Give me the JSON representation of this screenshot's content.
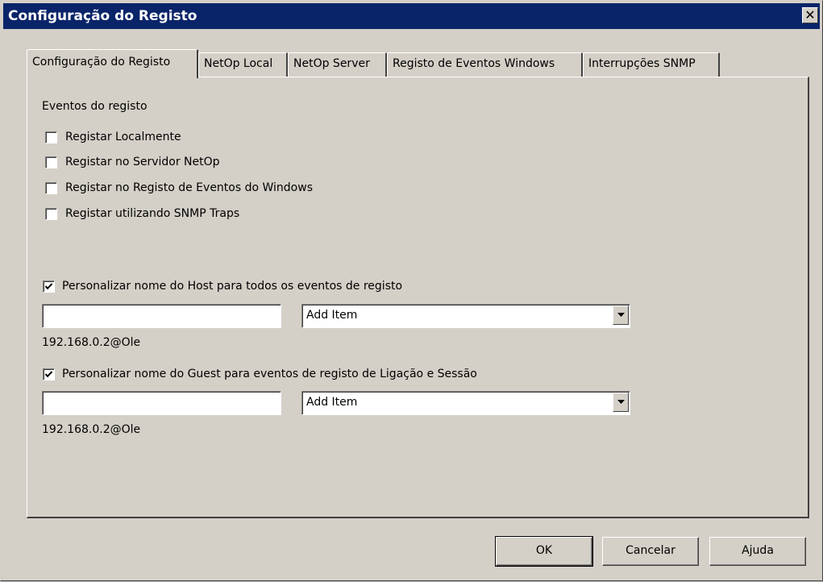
{
  "window": {
    "title": "Configuração do Registo",
    "close_glyph": "✕"
  },
  "tabs": [
    {
      "label": "Configuração do Registo",
      "active": true
    },
    {
      "label": "NetOp Local",
      "active": false
    },
    {
      "label": "NetOp Server",
      "active": false
    },
    {
      "label": "Registo de Eventos Windows",
      "active": false
    },
    {
      "label": "Interrupções SNMP",
      "active": false
    }
  ],
  "events": {
    "group_label": "Eventos do registo",
    "options": [
      {
        "label": "Registar Localmente",
        "checked": false
      },
      {
        "label": "Registar no Servidor NetOp",
        "checked": false
      },
      {
        "label": "Registar no Registo de Eventos do Windows",
        "checked": false
      },
      {
        "label": "Registar utilizando SNMP Traps",
        "checked": false
      }
    ]
  },
  "host": {
    "checkbox_label": "Personalizar nome do Host para todos os eventos de registo",
    "checked": true,
    "text_value": "",
    "combo_value": "Add Item",
    "preview": "192.168.0.2@Ole"
  },
  "guest": {
    "checkbox_label": "Personalizar nome do Guest para eventos de registo de Ligação e Sessão",
    "checked": true,
    "text_value": "",
    "combo_value": "Add Item",
    "preview": "192.168.0.2@Ole"
  },
  "buttons": {
    "ok": "OK",
    "cancel": "Cancelar",
    "help": "Ajuda"
  },
  "colors": {
    "titlebar": "#0a246a",
    "face": "#d4d0c8"
  }
}
